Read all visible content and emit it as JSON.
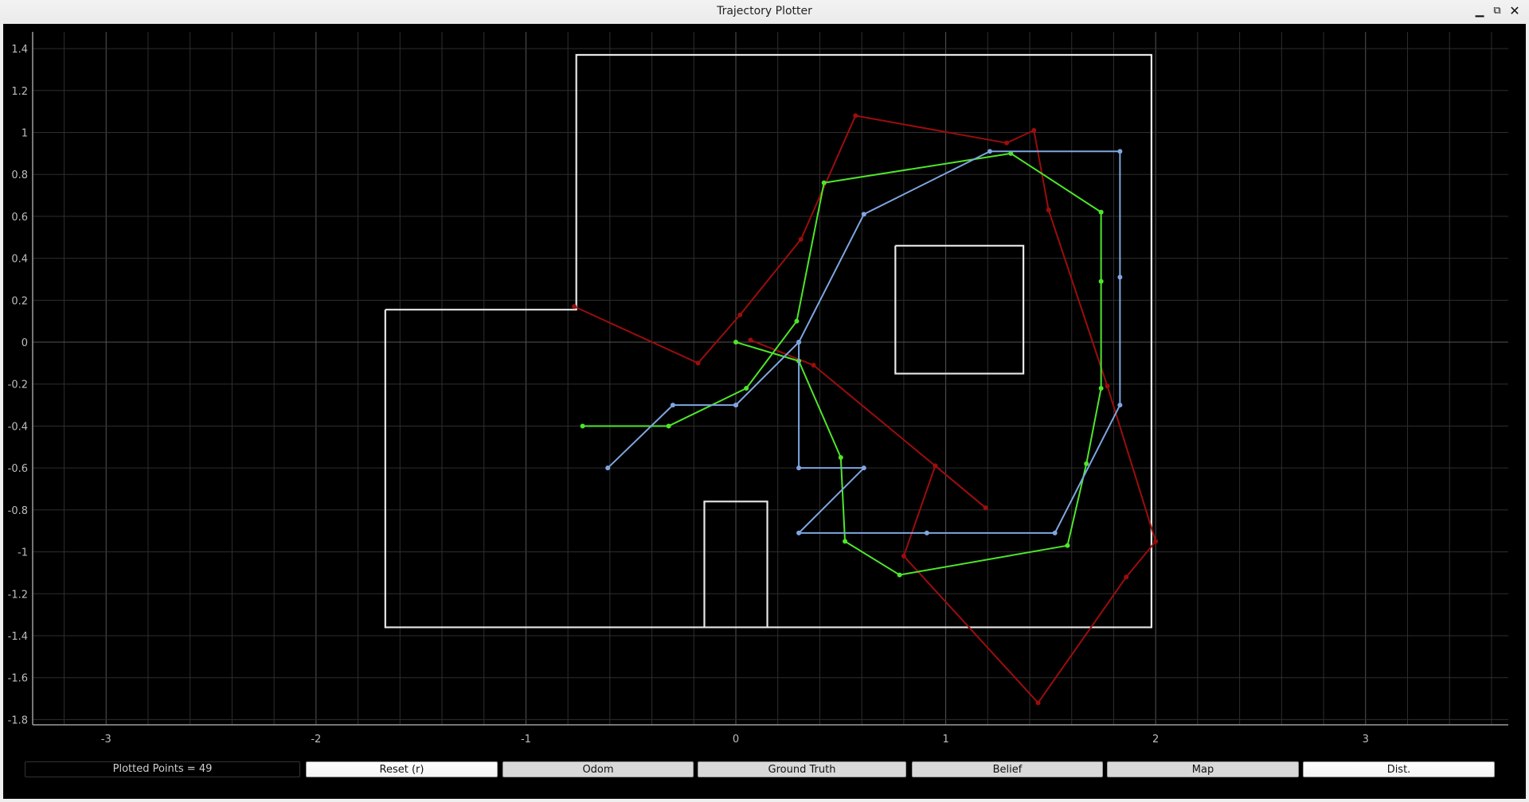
{
  "window": {
    "title": "Trajectory Plotter",
    "controls": {
      "minimize": "▁",
      "maximize": "⧉",
      "close": "✕"
    }
  },
  "status": {
    "plotted_points_label": "Plotted Points = 49",
    "plotted_points": 49
  },
  "buttons": [
    {
      "id": "reset",
      "label": "Reset (r)",
      "active": true
    },
    {
      "id": "odom",
      "label": "Odom",
      "active": false
    },
    {
      "id": "ground-truth",
      "label": "Ground Truth",
      "active": false
    },
    {
      "id": "belief",
      "label": "Belief",
      "active": false
    },
    {
      "id": "map",
      "label": "Map",
      "active": false
    },
    {
      "id": "dist",
      "label": "Dist.",
      "active": true
    }
  ],
  "colors": {
    "background": "#000000",
    "grid": "#2e2e2e",
    "axis": "#9e9e9e",
    "map": "#e8e8e8",
    "odom": "#9b0d0d",
    "ground_truth": "#4ee62a",
    "belief": "#7fa6e0"
  },
  "chart_data": {
    "type": "line",
    "title": "",
    "xlabel": "",
    "ylabel": "",
    "xlim": [
      -3.35,
      3.68
    ],
    "ylim": [
      -1.825,
      1.48
    ],
    "grid": true,
    "grid_step": 0.2,
    "x_ticks": [
      -3,
      -2,
      -1,
      0,
      1,
      2,
      3
    ],
    "x_tick_labels": [
      "-3",
      "-2",
      "-1",
      "0",
      "1",
      "2",
      "3"
    ],
    "y_ticks": [
      1.4,
      1.2,
      1,
      0.8,
      0.6,
      0.4,
      0.2,
      0,
      -0.2,
      -0.4,
      -0.6,
      -0.8,
      -1,
      -1.2,
      -1.4,
      -1.6,
      -1.8
    ],
    "y_tick_labels": [
      "1.4",
      "1.2",
      "1",
      "0.8",
      "0.6",
      "0.4",
      "0.2",
      "0",
      "-0.2",
      "-0.4",
      "-0.6",
      "-0.8",
      "-1",
      "-1.2",
      "-1.4",
      "-1.6",
      "-1.8"
    ],
    "map_segments": [
      {
        "name": "outer-wall",
        "points": [
          [
            -1.67,
            0.155
          ],
          [
            -0.76,
            0.155
          ],
          [
            -0.76,
            1.37
          ],
          [
            1.98,
            1.37
          ],
          [
            1.98,
            -1.36
          ],
          [
            -1.67,
            -1.36
          ],
          [
            -1.67,
            0.155
          ]
        ]
      },
      {
        "name": "obstacle-box",
        "points": [
          [
            0.76,
            0.46
          ],
          [
            1.37,
            0.46
          ],
          [
            1.37,
            -0.15
          ],
          [
            0.76,
            -0.15
          ],
          [
            0.76,
            0.46
          ]
        ]
      },
      {
        "name": "obstacle-door",
        "points": [
          [
            -0.15,
            -1.36
          ],
          [
            -0.15,
            -0.76
          ],
          [
            0.15,
            -0.76
          ],
          [
            0.15,
            -1.36
          ]
        ]
      }
    ],
    "series": [
      {
        "name": "Odom",
        "color": "#9b0d0d",
        "segments": [
          [
            [
              0.07,
              0.01
            ],
            [
              0.37,
              -0.11
            ],
            [
              0.95,
              -0.59
            ],
            [
              1.19,
              -0.79
            ]
          ],
          [
            [
              -0.77,
              0.17
            ],
            [
              -0.18,
              -0.1
            ],
            [
              0.02,
              0.13
            ],
            [
              0.31,
              0.49
            ],
            [
              0.57,
              1.08
            ],
            [
              1.29,
              0.95
            ],
            [
              1.42,
              1.01
            ],
            [
              1.49,
              0.63
            ],
            [
              1.77,
              -0.21
            ],
            [
              2.0,
              -0.95
            ],
            [
              1.86,
              -1.12
            ],
            [
              1.44,
              -1.72
            ],
            [
              0.8,
              -1.02
            ],
            [
              0.95,
              -0.59
            ],
            [
              1.19,
              -0.79
            ]
          ]
        ]
      },
      {
        "name": "Ground Truth",
        "color": "#4ee62a",
        "segments": [
          [
            [
              0.0,
              0.0
            ],
            [
              0.3,
              -0.09
            ],
            [
              0.5,
              -0.55
            ],
            [
              0.52,
              -0.95
            ],
            [
              0.78,
              -1.11
            ],
            [
              1.58,
              -0.97
            ],
            [
              1.67,
              -0.58
            ],
            [
              1.74,
              -0.22
            ],
            [
              1.74,
              0.29
            ],
            [
              1.74,
              0.62
            ],
            [
              1.31,
              0.9
            ],
            [
              0.42,
              0.76
            ],
            [
              0.29,
              0.1
            ],
            [
              0.05,
              -0.22
            ],
            [
              -0.32,
              -0.4
            ],
            [
              -0.73,
              -0.4
            ]
          ]
        ]
      },
      {
        "name": "Belief",
        "color": "#7fa6e0",
        "segments": [
          [
            [
              0.0,
              -0.3
            ],
            [
              -0.3,
              -0.3
            ],
            [
              -0.61,
              -0.6
            ]
          ],
          [
            [
              0.0,
              -0.3
            ],
            [
              0.3,
              0.0
            ],
            [
              0.61,
              0.61
            ],
            [
              1.21,
              0.91
            ],
            [
              1.83,
              0.91
            ],
            [
              1.83,
              0.31
            ],
            [
              1.83,
              -0.3
            ],
            [
              1.52,
              -0.91
            ],
            [
              0.91,
              -0.91
            ],
            [
              0.3,
              -0.91
            ],
            [
              0.61,
              -0.6
            ],
            [
              0.3,
              -0.6
            ],
            [
              0.3,
              0.0
            ]
          ]
        ]
      }
    ]
  }
}
